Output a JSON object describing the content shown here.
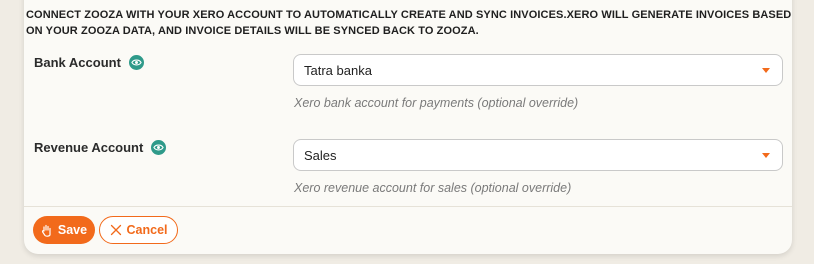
{
  "intro": "CONNECT ZOOZA WITH YOUR XERO ACCOUNT TO AUTOMATICALLY CREATE AND SYNC INVOICES.XERO WILL GENERATE INVOICES BASED ON YOUR ZOOZA DATA, AND INVOICE DETAILS WILL BE SYNCED BACK TO ZOOZA.",
  "fields": [
    {
      "label": "Bank Account",
      "icon": "eye-icon",
      "value": "Tatra banka",
      "hint": "Xero bank account for payments (optional override)"
    },
    {
      "label": "Revenue Account",
      "icon": "eye-icon",
      "value": "Sales",
      "hint": "Xero revenue account for sales (optional override)"
    }
  ],
  "actions": {
    "save_label": "Save",
    "save_icon": "hand-icon",
    "cancel_label": "Cancel",
    "cancel_icon": "close-icon"
  },
  "colors": {
    "accent": "#f26a1b",
    "info_icon": "#2f9a8a",
    "card_bg": "#fbfaf6"
  }
}
